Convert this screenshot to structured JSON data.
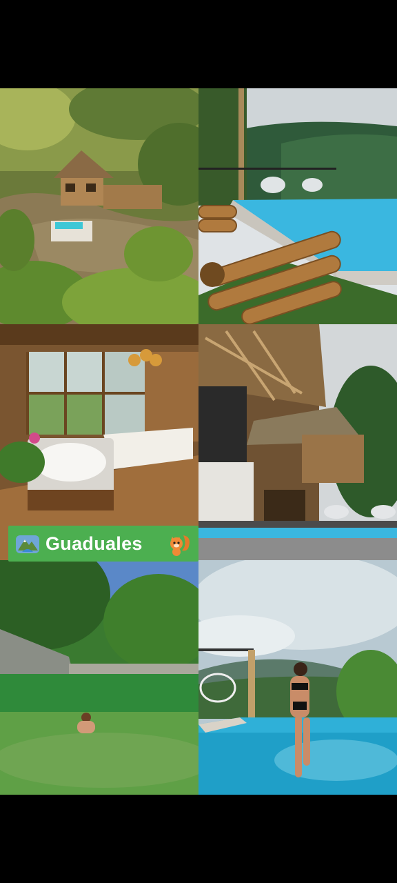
{
  "banner": {
    "title": "Guaduales",
    "left_icon": "national-park-emoji-icon",
    "right_icon": "squirrel-emoji-icon",
    "background_color": "#4caf50"
  },
  "photos": [
    {
      "id": "aerial-bamboo-cabin"
    },
    {
      "id": "bamboo-pool-deck"
    },
    {
      "id": "bedroom-with-jacuzzi"
    },
    {
      "id": "bamboo-lodge-exterior"
    },
    {
      "id": "river-swimming"
    },
    {
      "id": "infinity-pool-mountains"
    }
  ]
}
